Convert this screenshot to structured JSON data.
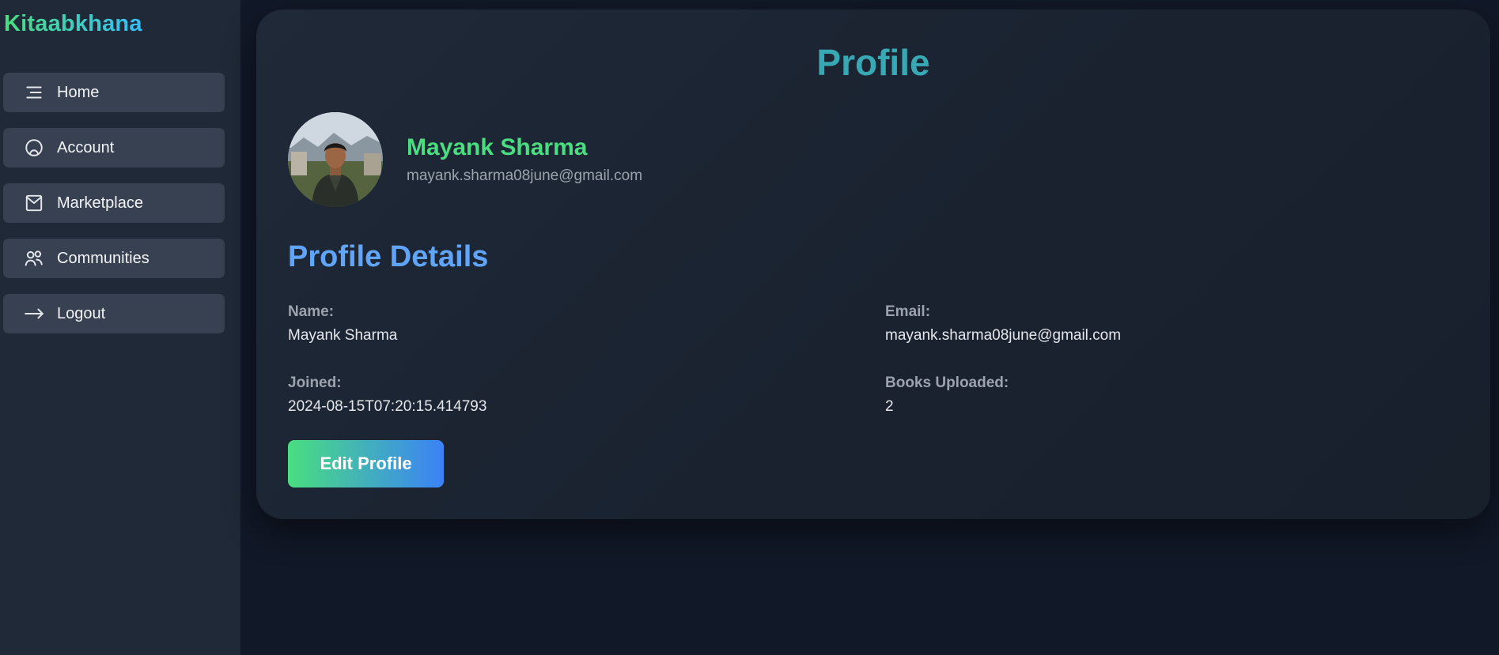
{
  "sidebar": {
    "brand": "Kitaabkhana",
    "items": [
      {
        "label": "Home",
        "icon": "menu-icon"
      },
      {
        "label": "Account",
        "icon": "account-icon"
      },
      {
        "label": "Marketplace",
        "icon": "mail-icon"
      },
      {
        "label": "Communities",
        "icon": "users-icon"
      },
      {
        "label": "Logout",
        "icon": "arrow-right-icon"
      }
    ]
  },
  "profile": {
    "title": "Profile",
    "name": "Mayank Sharma",
    "email": "mayank.sharma08june@gmail.com"
  },
  "details": {
    "title": "Profile Details",
    "name_label": "Name:",
    "name_value": "Mayank Sharma",
    "email_label": "Email:",
    "email_value": "mayank.sharma08june@gmail.com",
    "joined_label": "Joined:",
    "joined_value": "2024-08-15T07:20:15.414793",
    "books_label": "Books Uploaded:",
    "books_value": "2"
  },
  "actions": {
    "edit_label": "Edit Profile"
  },
  "colors": {
    "background": "#111827",
    "sidebar": "#1f2937",
    "nav_item": "#374151",
    "title": "#38a9b4",
    "name": "#4ade80",
    "section": "#60a5fa",
    "button_start": "#4ade80",
    "button_end": "#3b82f6"
  }
}
